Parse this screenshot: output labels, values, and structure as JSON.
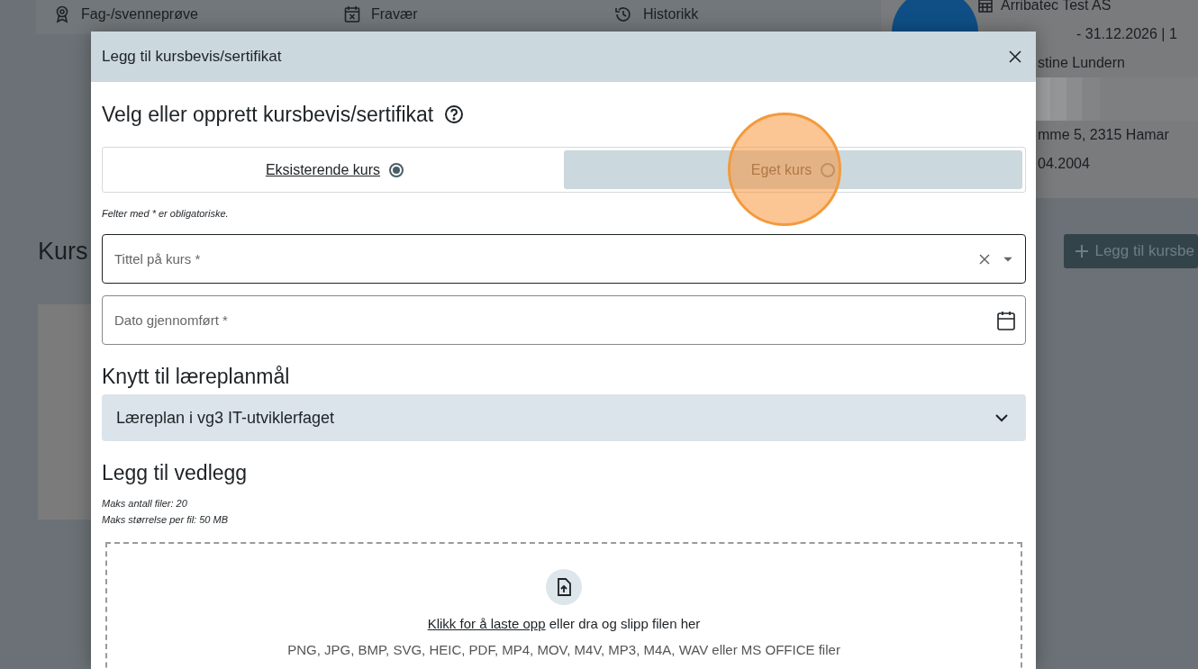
{
  "background_page": {
    "tabs": [
      {
        "label": "Fag-/svenneprøve"
      },
      {
        "label": "Fravær"
      },
      {
        "label": "Historikk"
      }
    ],
    "profile": {
      "company": "Arribatec Test AS",
      "period": "- 31.12.2026 | 1",
      "lines": [
        "stine Lundern",
        "mme 5, 2315 Hamar",
        "04.2004"
      ]
    },
    "section_title": "Kurs",
    "add_button": "Legg til kursbe"
  },
  "dialog": {
    "title": "Legg til kursbevis/sertifikat",
    "heading": "Velg eller opprett kursbevis/sertifikat",
    "options": [
      {
        "label": "Eksisterende kurs",
        "selected": true
      },
      {
        "label": "Eget kurs",
        "selected": false
      }
    ],
    "required_note": "Felter med * er obligatoriske.",
    "fields": [
      {
        "kind": "select",
        "placeholder": "Tittel på kurs *",
        "focused": true
      },
      {
        "kind": "date",
        "placeholder": "Dato gjennomført *",
        "focused": false
      }
    ],
    "curriculum_heading": "Knytt til læreplanmål",
    "curriculum": {
      "label": "Læreplan i vg3 IT-utviklerfaget",
      "expanded": false
    },
    "attachments_heading": "Legg til vedlegg",
    "limits": [
      "Maks antall filer: 20",
      "Maks størrelse per fil: 50 MB"
    ],
    "dropzone": {
      "link": "Klikk for å laste opp",
      "text": " eller dra og slipp filen her",
      "formats": "PNG, JPG, BMP, SVG, HEIC, PDF, MP4, MOV, M4V, MP3, M4A, WAV eller MS OFFICE filer"
    }
  },
  "click_indicator": {
    "visible": true
  }
}
